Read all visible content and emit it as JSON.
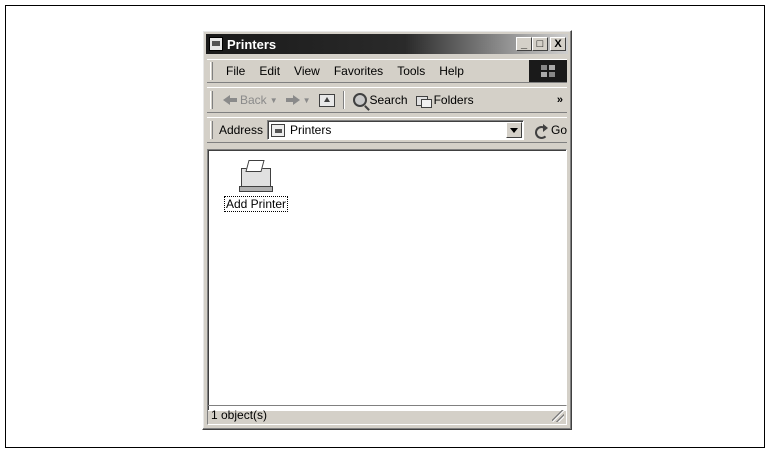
{
  "window": {
    "title": "Printers",
    "minimize_label": "_",
    "maximize_label": "□",
    "close_label": "X"
  },
  "menu": {
    "items": [
      {
        "label": "File"
      },
      {
        "label": "Edit"
      },
      {
        "label": "View"
      },
      {
        "label": "Favorites"
      },
      {
        "label": "Tools"
      },
      {
        "label": "Help"
      }
    ]
  },
  "toolbar": {
    "back_label": "Back",
    "search_label": "Search",
    "folders_label": "Folders",
    "more_label": "»"
  },
  "address": {
    "label": "Address",
    "value": "Printers",
    "go_label": "Go"
  },
  "content": {
    "items": [
      {
        "label": "Add Printer",
        "icon": "add-printer-icon"
      }
    ]
  },
  "status": {
    "text": "1 object(s)"
  }
}
